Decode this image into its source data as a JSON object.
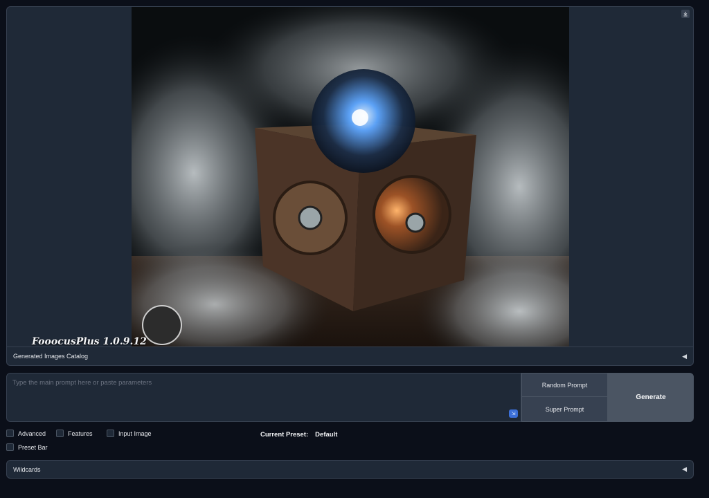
{
  "gallery": {
    "watermark_text": "FooocusPlus 1.0.9.12",
    "download_icon": "download-icon",
    "image_subject": "ornate clockwork cube with glowing crystal orb in smoke"
  },
  "catalog": {
    "label": "Generated Images Catalog",
    "toggle_icon": "triangle-left-icon"
  },
  "prompt": {
    "value": "",
    "placeholder": "Type the main prompt here or paste parameters",
    "mini_button_icon": "expand-icon"
  },
  "buttons": {
    "random_prompt": "Random Prompt",
    "super_prompt": "Super Prompt",
    "generate": "Generate"
  },
  "options": {
    "advanced": "Advanced",
    "features": "Features",
    "input_image": "Input Image",
    "preset_bar": "Preset Bar"
  },
  "preset": {
    "label": "Current Preset:",
    "value": "Default"
  },
  "wildcards": {
    "label": "Wildcards"
  },
  "colors": {
    "background": "#0b0f19",
    "panel": "#1f2937",
    "button": "#374151",
    "generate": "#4b5563"
  }
}
